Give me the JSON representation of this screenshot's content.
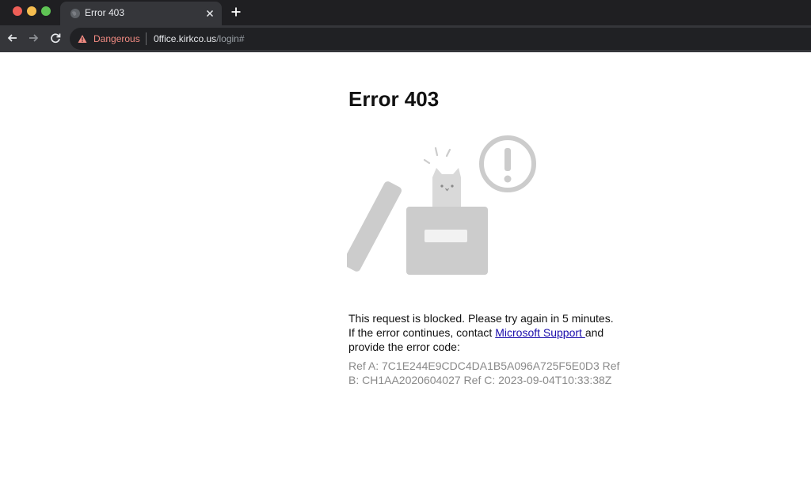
{
  "browser": {
    "tab_title": "Error 403",
    "security_label": "Dangerous",
    "url_host": "0ffice.kirkco.us",
    "url_path": "/login#",
    "colors": {
      "tabbar_bg": "#1f1f22",
      "toolbar_bg": "#35363a",
      "danger": "#f28b82"
    },
    "icons": [
      "globe-icon",
      "close-icon",
      "plus-icon",
      "back-arrow-icon",
      "forward-arrow-icon",
      "reload-icon",
      "warning-icon"
    ]
  },
  "page": {
    "title": "Error 403",
    "message_before_link": "This request is blocked. Please try again in 5 minutes. If the error continues, contact ",
    "link_text": "Microsoft Support ",
    "message_after_link": "and provide the error code:",
    "refs_text": "Ref A: 7C1E244E9CDC4DA1B5A096A725F5E0D3 Ref B: CH1AA2020604027 Ref C: 2023-09-04T10:33:38Z",
    "colors": {
      "illustration_gray": "#cccccc",
      "link": "#1a0dab",
      "refs_text": "#8a8a8a"
    }
  }
}
